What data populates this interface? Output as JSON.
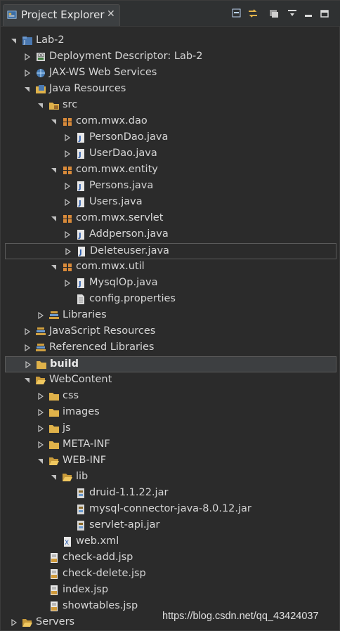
{
  "panel": {
    "title": "Project Explorer",
    "close_glyph": "✕"
  },
  "toolbar": {
    "buttons": [
      {
        "name": "collapse-all-icon"
      },
      {
        "name": "link-with-editor-icon"
      },
      {
        "name": "focus-icon"
      },
      {
        "name": "view-menu-icon"
      },
      {
        "name": "minimize-icon"
      },
      {
        "name": "maximize-icon"
      }
    ]
  },
  "tree": [
    {
      "label": "Lab-2",
      "icon": "project",
      "twisty": "open",
      "bold": false
    },
    {
      "label": "Deployment Descriptor: Lab-2",
      "icon": "descriptor",
      "twisty": "closed"
    },
    {
      "label": "JAX-WS Web Services",
      "icon": "webservice",
      "twisty": "closed"
    },
    {
      "label": "Java Resources",
      "icon": "javares",
      "twisty": "open"
    },
    {
      "label": "src",
      "icon": "srcfolder",
      "twisty": "open"
    },
    {
      "label": "com.mwx.dao",
      "icon": "package",
      "twisty": "open"
    },
    {
      "label": "PersonDao.java",
      "icon": "java",
      "twisty": "closed"
    },
    {
      "label": "UserDao.java",
      "icon": "java",
      "twisty": "closed"
    },
    {
      "label": "com.mwx.entity",
      "icon": "package",
      "twisty": "open"
    },
    {
      "label": "Persons.java",
      "icon": "java",
      "twisty": "closed"
    },
    {
      "label": "Users.java",
      "icon": "java",
      "twisty": "closed"
    },
    {
      "label": "com.mwx.servlet",
      "icon": "package",
      "twisty": "open"
    },
    {
      "label": "Addperson.java",
      "icon": "java",
      "twisty": "closed"
    },
    {
      "label": "Deleteuser.java",
      "icon": "java",
      "twisty": "closed",
      "selected": true
    },
    {
      "label": "com.mwx.util",
      "icon": "package",
      "twisty": "open"
    },
    {
      "label": "MysqlOp.java",
      "icon": "java",
      "twisty": "closed"
    },
    {
      "label": "config.properties",
      "icon": "file",
      "twisty": "none"
    },
    {
      "label": "Libraries",
      "icon": "library",
      "twisty": "closed"
    },
    {
      "label": "JavaScript Resources",
      "icon": "library",
      "twisty": "closed"
    },
    {
      "label": "Referenced Libraries",
      "icon": "library",
      "twisty": "closed"
    },
    {
      "label": "build",
      "icon": "folder",
      "twisty": "closed",
      "bold": true,
      "selected": true,
      "filled": true
    },
    {
      "label": "WebContent",
      "icon": "folderopen",
      "twisty": "open"
    },
    {
      "label": "css",
      "icon": "folder",
      "twisty": "closed"
    },
    {
      "label": "images",
      "icon": "folder",
      "twisty": "closed"
    },
    {
      "label": "js",
      "icon": "folder",
      "twisty": "closed"
    },
    {
      "label": "META-INF",
      "icon": "folder",
      "twisty": "closed"
    },
    {
      "label": "WEB-INF",
      "icon": "folderopen",
      "twisty": "open"
    },
    {
      "label": "lib",
      "icon": "folderopen",
      "twisty": "open"
    },
    {
      "label": "druid-1.1.22.jar",
      "icon": "jar",
      "twisty": "none"
    },
    {
      "label": "mysql-connector-java-8.0.12.jar",
      "icon": "jar",
      "twisty": "none"
    },
    {
      "label": "servlet-api.jar",
      "icon": "jar",
      "twisty": "none"
    },
    {
      "label": "web.xml",
      "icon": "xml",
      "twisty": "none"
    },
    {
      "label": "check-add.jsp",
      "icon": "jsp",
      "twisty": "none"
    },
    {
      "label": "check-delete.jsp",
      "icon": "jsp",
      "twisty": "none"
    },
    {
      "label": "index.jsp",
      "icon": "jsp",
      "twisty": "none"
    },
    {
      "label": "showtables.jsp",
      "icon": "jsp",
      "twisty": "none"
    },
    {
      "label": "Servers",
      "icon": "folderopen",
      "twisty": "closed"
    }
  ],
  "watermark": "https://blog.csdn.net/qq_43424037",
  "colors": {
    "background": "#2b2b2b",
    "text": "#d6d6d6",
    "folder": "#e0b24a",
    "java": "#d7b34a",
    "package": "#c98a3a"
  }
}
